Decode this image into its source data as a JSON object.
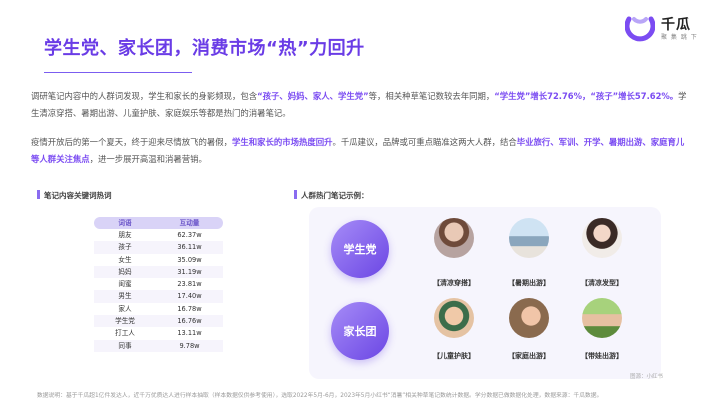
{
  "brand": {
    "name": "千瓜",
    "tagline": "聚 集 跳 下"
  },
  "title": "学生党、家长团，消费市场“热”力回升",
  "para1": {
    "s1": "调研笔记内容中的人群词发现，学生和家长的身影频现，包含",
    "h1": "“孩子、妈妈、家人、学生党”",
    "s2": "等，相关种草笔记数较去年同期，",
    "h2": "“学生党”增长72.76%，“孩子”增长57.62%。",
    "s3": "学生清凉穿搭、暑期出游、儿童护肤、家庭娱乐等都是热门的消暑笔记。"
  },
  "para2": {
    "s1": "疫情开放后的第一个夏天，终于迎来尽情放飞的暑假，",
    "h1": "学生和家长的市场热度回升",
    "s2": "。千瓜建议，品牌或可重点瞄准这两大人群，结合",
    "h2": "毕业旅行、军训、开学、暑期出游、家庭育儿等人群关注焦点",
    "s3": "，进一步展开高温和消暑营销。"
  },
  "left_section_title": "笔记内容关键词热词",
  "right_section_title": "人群热门笔记示例：",
  "table": {
    "headers": [
      "词语",
      "互动量"
    ],
    "rows": [
      [
        "朋友",
        "62.37w"
      ],
      [
        "孩子",
        "36.11w"
      ],
      [
        "女生",
        "35.09w"
      ],
      [
        "妈妈",
        "31.19w"
      ],
      [
        "闺蜜",
        "23.81w"
      ],
      [
        "男生",
        "17.40w"
      ],
      [
        "家人",
        "16.78w"
      ],
      [
        "学生党",
        "16.76w"
      ],
      [
        "打工人",
        "13.11w"
      ],
      [
        "同事",
        "9.78w"
      ]
    ]
  },
  "groups": {
    "student": {
      "label": "学生党",
      "notes": [
        "【清凉穿搭】",
        "【暑期出游】",
        "【清凉发型】"
      ]
    },
    "parent": {
      "label": "家长团",
      "notes": [
        "【儿童护肤】",
        "【家庭出游】",
        "【带娃出游】"
      ]
    }
  },
  "watermark": "图源：小红书",
  "footer": "数据说明：基于千瓜超1亿件发达人，近千万优质达人进行样本抽取（样本数据仅供参考使用），选取2022年5月-6月，2023年5月小红书“消暑”相关种草笔记数统计数据。学分数据已做数据化处理，数据来源：千瓜数据。",
  "colors": {
    "accent": "#6a3ce6",
    "highlight": "#7b4cf2",
    "panel": "#f6f5fd"
  }
}
